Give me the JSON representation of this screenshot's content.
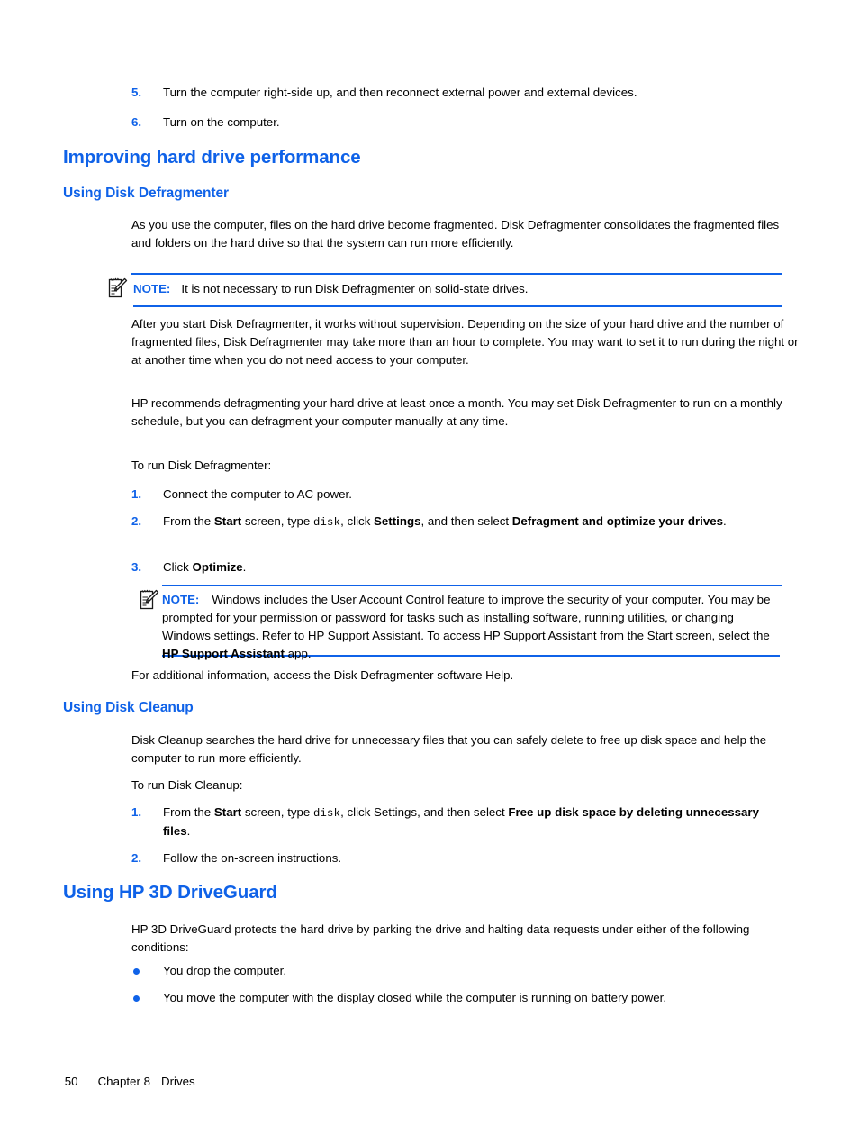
{
  "document": {
    "page_number": "50",
    "chapter": "Chapter 8",
    "section": "Drives",
    "accent_color": "#0F62E8",
    "text_color": "#000000",
    "background": "#ffffff"
  },
  "top_list": {
    "items": [
      {
        "number": "5.",
        "text": "Turn the computer right-side up, and then reconnect external power and external devices."
      },
      {
        "number": "6.",
        "text": "Turn on the computer."
      }
    ]
  },
  "headings": {
    "h1_improving": "Improving hard drive performance",
    "h2_defragmenter": "Using Disk Defragmenter",
    "h2_cleanup": "Using Disk Cleanup",
    "h1_driveguard": "Using HP 3D DriveGuard"
  },
  "defragmenter": {
    "intro": "As you use the computer, files on the hard drive become fragmented. Disk Defragmenter consolidates the fragmented files and folders on the hard drive so that the system can run more efficiently.",
    "note1": {
      "label": "NOTE:",
      "text": "It is not necessary to run Disk Defragmenter on solid-state drives.",
      "icon": "note-pencil-icon"
    },
    "para_after_start": "After you start Disk Defragmenter, it works without supervision. Depending on the size of your hard drive and the number of fragmented files, Disk Defragmenter may take more than an hour to complete. You may want to set it to run during the night or at another time when you do not need access to your computer.",
    "para_recommends": "HP recommends defragmenting your hard drive at least once a month. You may set Disk Defragmenter to run on a monthly schedule, but you can defragment your computer manually at any time.",
    "to_run": "To run Disk Defragmenter:",
    "steps": [
      {
        "number": "1.",
        "parts": [
          {
            "type": "plain",
            "text": "Connect the computer to AC power."
          }
        ]
      },
      {
        "number": "2.",
        "parts": [
          {
            "type": "plain",
            "text": "From the "
          },
          {
            "type": "bold",
            "text": "Start"
          },
          {
            "type": "plain",
            "text": " screen, type "
          },
          {
            "type": "mono",
            "text": "disk"
          },
          {
            "type": "plain",
            "text": ", click "
          },
          {
            "type": "bold",
            "text": "Settings"
          },
          {
            "type": "plain",
            "text": ", and then select "
          },
          {
            "type": "bold",
            "text": "Defragment and optimize your drives"
          },
          {
            "type": "plain",
            "text": "."
          }
        ]
      },
      {
        "number": "3.",
        "parts": [
          {
            "type": "plain",
            "text": "Click "
          },
          {
            "type": "bold",
            "text": "Optimize"
          },
          {
            "type": "plain",
            "text": "."
          }
        ]
      }
    ],
    "note2": {
      "label": "NOTE:",
      "icon": "note-pencil-icon",
      "parts": [
        {
          "type": "plain",
          "text": "Windows includes the User Account Control feature to improve the security of your computer. You may be prompted for your permission or password for tasks such as installing software, running utilities, or changing Windows settings. Refer to HP Support Assistant. To access HP Support Assistant from the Start screen, select the "
        },
        {
          "type": "bold",
          "text": "HP Support Assistant"
        },
        {
          "type": "plain",
          "text": " app."
        }
      ]
    },
    "additional_info": "For additional information, access the Disk Defragmenter software Help."
  },
  "cleanup": {
    "intro": "Disk Cleanup searches the hard drive for unnecessary files that you can safely delete to free up disk space and help the computer to run more efficiently.",
    "to_run": "To run Disk Cleanup:",
    "steps": [
      {
        "number": "1.",
        "parts": [
          {
            "type": "plain",
            "text": "From the "
          },
          {
            "type": "bold",
            "text": "Start"
          },
          {
            "type": "plain",
            "text": " screen, type "
          },
          {
            "type": "mono",
            "text": "disk"
          },
          {
            "type": "plain",
            "text": ", click Settings, and then select "
          },
          {
            "type": "bold",
            "text": "Free up disk space by deleting unnecessary files"
          },
          {
            "type": "plain",
            "text": "."
          }
        ]
      },
      {
        "number": "2.",
        "parts": [
          {
            "type": "plain",
            "text": "Follow the on-screen instructions."
          }
        ]
      }
    ]
  },
  "driveguard": {
    "intro": "HP 3D DriveGuard protects the hard drive by parking the drive and halting data requests under either of the following conditions:",
    "bullets": [
      "You drop the computer.",
      "You move the computer with the display closed while the computer is running on battery power."
    ]
  }
}
